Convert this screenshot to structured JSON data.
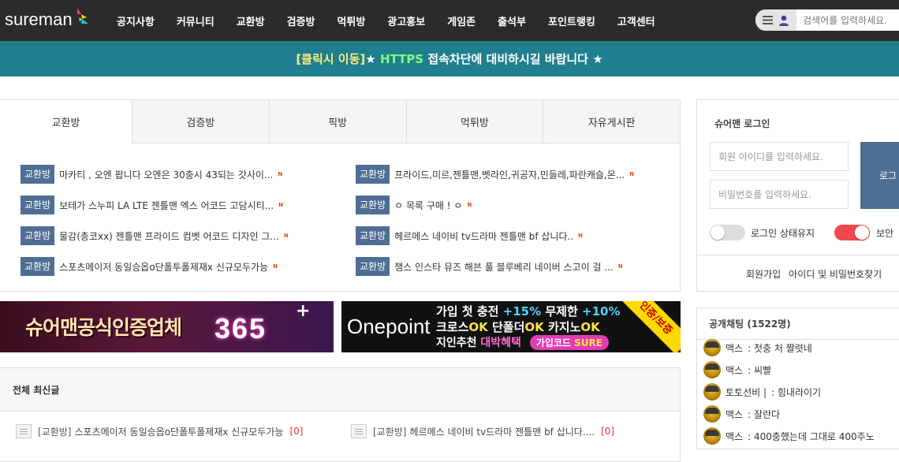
{
  "header": {
    "logo_text": "sureman",
    "nav": [
      "공지사항",
      "커뮤니티",
      "교환방",
      "검증방",
      "먹튀방",
      "광고홍보",
      "게임존",
      "출석부",
      "포인트랭킹",
      "고객센터"
    ],
    "search_placeholder": "검색어를 입력하세요."
  },
  "notice": {
    "link": "[클릭시 이동]",
    "star1": "★ ",
    "https": "HTTPS",
    "text": " 접속차단에 대비하시길 바랍니다 ★"
  },
  "board_tabs": {
    "tabs": [
      "교환방",
      "검증방",
      "픽방",
      "먹튀방",
      "자유게시판"
    ],
    "active": "교환방",
    "posts_left": [
      {
        "badge": "교환방",
        "title": "마카티 , 오엔 팝니다 오엔은 30충시 43되는 갓사이...",
        "new": "N"
      },
      {
        "badge": "교환방",
        "title": "보테가 스누피 LA LTE 젠틀맨 엑스 어코드 고담시티...",
        "new": "N"
      },
      {
        "badge": "교환방",
        "title": "물감(총코xx) 젠틀맨 프라이드 컴벳 어코드 디자인 그...",
        "new": "N"
      },
      {
        "badge": "교환방",
        "title": "스포츠메이저 동일승옵o단폴투폴제재x 신규모두가능",
        "new": "N"
      }
    ],
    "posts_right": [
      {
        "badge": "교환방",
        "title": "프라이드,미르,젠틀맨,벳라인,귀공자,민들레,파란캐슬,몬...",
        "new": "N"
      },
      {
        "badge": "교환방",
        "title": "ㅇ 목록 구매 ! ㅇ",
        "new": "N"
      },
      {
        "badge": "교환방",
        "title": "헤르메스 네이비 tv드라마 젠틀맨 bf 삽니다..",
        "new": "N"
      },
      {
        "badge": "교환방",
        "title": "챔스 인스타 뮤즈 해븐 풀 블루베리 네이버 스고이 걸 ...",
        "new": "N"
      }
    ]
  },
  "banners": {
    "b1_text": "슈어맨공식인증업체",
    "b1_num": "365",
    "b1_plus": "+",
    "b2_logo": "Onepoint",
    "b2_l1a": "가입 첫 충전 ",
    "b2_l1b": "+15%",
    "b2_l1c": " 무제한 ",
    "b2_l1d": "+10%",
    "b2_l2a": "크로스",
    "b2_l2b": "OK",
    "b2_l2c": " 단폴더",
    "b2_l2d": "OK",
    "b2_l2e": " 카지노",
    "b2_l2f": "OK",
    "b2_l3a": "지인추천 ",
    "b2_l3b": "대박혜택",
    "b2_code_label": "가입코드 ",
    "b2_code": "SURE",
    "b2_ribbon": "인증/보증"
  },
  "latest": {
    "title": "전체 최신글",
    "items": [
      {
        "cat": "[교환방]",
        "title": "스포츠메이저 동일승옵o단폴투폴제재x 신규모두가능",
        "count": "[0]"
      },
      {
        "cat": "[교환방]",
        "title": "헤르메스 네이비 tv드라마 젠틀맨 bf 삽니다....",
        "count": "[0]"
      }
    ]
  },
  "login": {
    "title": "슈어맨 로그인",
    "id_placeholder": "회원 아이디를 입력하세요.",
    "pw_placeholder": "비밀번호를 입력하세요.",
    "button": "로그",
    "keep_label": "로그인 상태유지",
    "secure_label": "보안 ",
    "signup": "회원가입",
    "find": "아이디 및 비밀번호찾기"
  },
  "chat": {
    "title": "공개채팅 (1522명)",
    "lines": [
      {
        "name": "맥스",
        "msg": ": 첫충 처 짤렷네"
      },
      {
        "name": "맥스",
        "msg": ": 씨빨"
      },
      {
        "name": "토토선비 |",
        "msg": ": 힘내라이기"
      },
      {
        "name": "맥스",
        "msg": ": 잘란다"
      },
      {
        "name": "맥스",
        "msg": ": 400충했는데 그대로 400주노"
      }
    ]
  },
  "colors": {
    "topbar": "#2b2b2b",
    "notice_bg": "#1f7f8f",
    "badge": "#4f6e93",
    "new": "#e84c0a"
  }
}
